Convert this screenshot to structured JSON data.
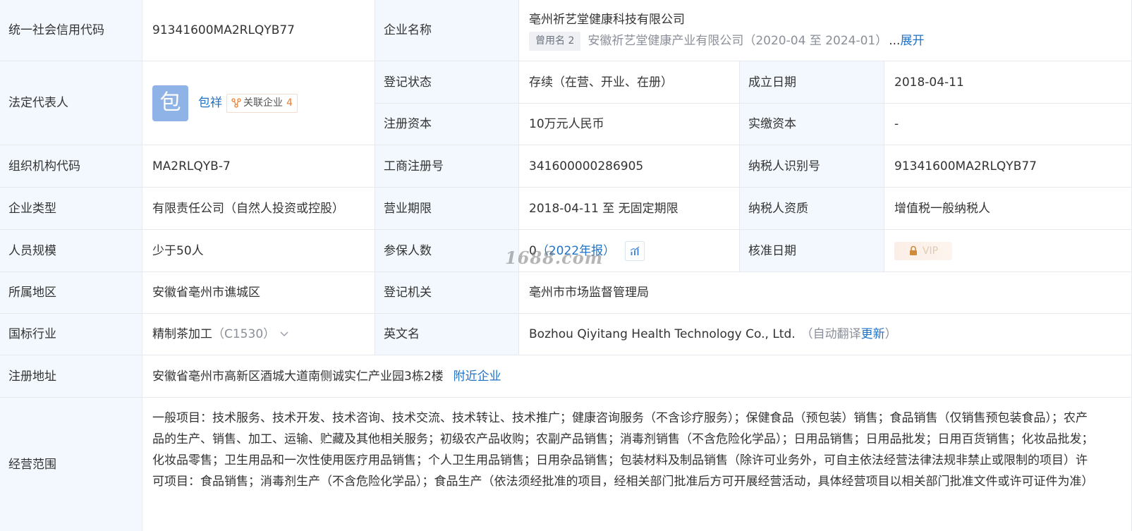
{
  "rows": {
    "credit_code": {
      "label": "统一社会信用代码",
      "value": "91341600MA2RLQYB77"
    },
    "company_name": {
      "label": "企业名称",
      "value": "亳州祈艺堂健康科技有限公司",
      "former_tag": "曾用名 2",
      "former_name": "安徽祈艺堂健康产业有限公司（2020-04 至 2024-01）",
      "expand_prefix": "...",
      "expand": "展开"
    },
    "legal_rep": {
      "label": "法定代表人",
      "avatar_char": "包",
      "name": "包祥",
      "related_label": "关联企业",
      "related_count": "4"
    },
    "reg_status": {
      "label": "登记状态",
      "value": "存续（在营、开业、在册）"
    },
    "founded": {
      "label": "成立日期",
      "value": "2018-04-11"
    },
    "reg_capital": {
      "label": "注册资本",
      "value": "10万元人民币"
    },
    "paid_capital": {
      "label": "实缴资本",
      "value": "-"
    },
    "org_code": {
      "label": "组织机构代码",
      "value": "MA2RLQYB-7"
    },
    "biz_reg_no": {
      "label": "工商注册号",
      "value": "341600000286905"
    },
    "taxpayer_id": {
      "label": "纳税人识别号",
      "value": "91341600MA2RLQYB77"
    },
    "company_type": {
      "label": "企业类型",
      "value": "有限责任公司（自然人投资或控股）"
    },
    "term": {
      "label": "营业期限",
      "value": "2018-04-11 至 无固定期限"
    },
    "taxpayer_qual": {
      "label": "纳税人资质",
      "value": "增值税一般纳税人"
    },
    "staff_size": {
      "label": "人员规模",
      "value": "少于50人"
    },
    "insured": {
      "label": "参保人数",
      "value": "0",
      "report": "（2022年报）"
    },
    "approval_date": {
      "label": "核准日期",
      "locked_text": "VIP"
    },
    "region": {
      "label": "所属地区",
      "value": "安徽省亳州市谯城区"
    },
    "reg_authority": {
      "label": "登记机关",
      "value": "亳州市市场监督管理局"
    },
    "industry": {
      "label": "国标行业",
      "value": "精制茶加工",
      "code": "（C1530）"
    },
    "english_name": {
      "label": "英文名",
      "value": "Bozhou Qiyitang Health Technology Co., Ltd.",
      "note_open": "（自动翻译",
      "update": "更新",
      "note_close": "）"
    },
    "address": {
      "label": "注册地址",
      "value": "安徽省亳州市高新区酒城大道南侧诚实仁产业园3栋2楼",
      "nearby": "附近企业"
    },
    "scope": {
      "label": "经营范围",
      "value": "一般项目：技术服务、技术开发、技术咨询、技术交流、技术转让、技术推广；健康咨询服务（不含诊疗服务）；保健食品（预包装）销售；食品销售（仅销售预包装食品）；农产品的生产、销售、加工、运输、贮藏及其他相关服务；初级农产品收购；农副产品销售；消毒剂销售（不含危险化学品）；日用品销售；日用品批发；日用百货销售；化妆品批发；化妆品零售；卫生用品和一次性使用医疗用品销售；个人卫生用品销售；日用杂品销售；包装材料及制品销售（除许可业务外，可自主依法经营法律法规非禁止或限制的项目）许可项目：食品销售；消毒剂生产（不含危险化学品）；食品生产（依法须经批准的项目，经相关部门批准后方可开展经营活动，具体经营项目以相关部门批准文件或许可证件为准）"
    }
  },
  "watermark": "1688.com"
}
